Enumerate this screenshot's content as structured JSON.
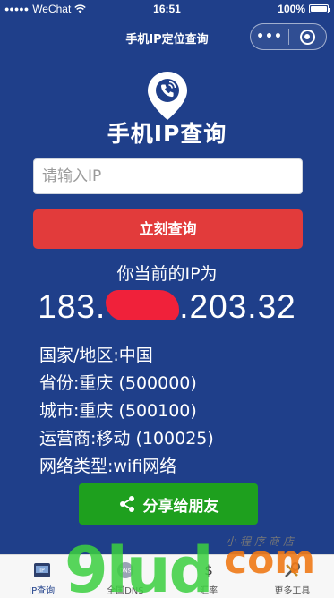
{
  "status_bar": {
    "carrier": "WeChat",
    "time": "16:51",
    "battery": "100%"
  },
  "navbar": {
    "title": "手机IP定位查询",
    "more_label": "•••"
  },
  "brand": {
    "title": "手机IP查询"
  },
  "search": {
    "placeholder": "请输入IP",
    "value": ""
  },
  "query_button": {
    "label": "立刻查询"
  },
  "result": {
    "heading": "你当前的IP为",
    "ip_prefix": "183.",
    "ip_suffix": ".203.32",
    "rows": [
      "国家/地区:中国",
      "省份:重庆 (500000)",
      "城市:重庆 (500100)",
      "运营商:移动 (100025)",
      "网络类型:wifi网络"
    ]
  },
  "share_button": {
    "label": "分享给朋友"
  },
  "tabbar": {
    "items": [
      {
        "label": "IP查询",
        "icon": "ip-query-icon"
      },
      {
        "label": "全国DNS",
        "icon": "dns-icon"
      },
      {
        "label": "汇率",
        "icon": "exchange-rate-icon"
      },
      {
        "label": "更多工具",
        "icon": "tools-icon"
      }
    ]
  },
  "watermark": {
    "text": "9lud",
    "suffix": "com",
    "cn": "小程序商店"
  },
  "colors": {
    "background": "#1f3f8a",
    "query_button": "#e23b3b",
    "share_button": "#1ea01e",
    "tab_active": "#1f3f8a"
  }
}
